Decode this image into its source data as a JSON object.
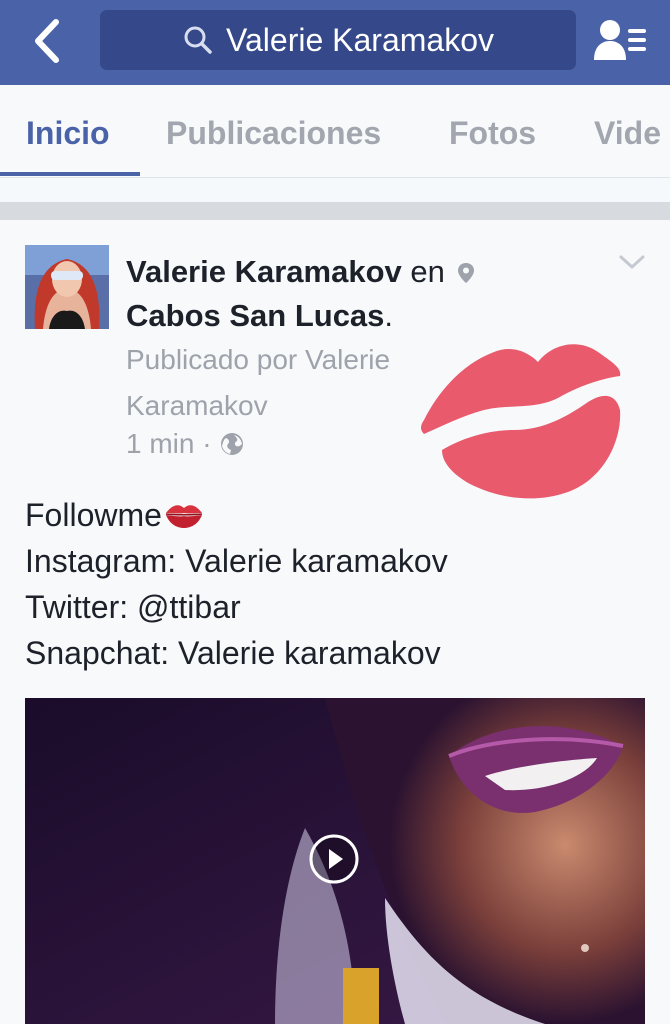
{
  "header": {
    "search_text": "Valerie Karamakov",
    "back_icon": "chevron-left-icon",
    "search_icon": "search-icon",
    "profile_icon": "friend-request-icon",
    "color": "#4a62a8"
  },
  "tabs": [
    {
      "label": "Inicio",
      "active": true
    },
    {
      "label": "Publicaciones",
      "active": false
    },
    {
      "label": "Fotos",
      "active": false
    },
    {
      "label": "Vide",
      "active": false
    }
  ],
  "post": {
    "author": "Valerie Karamakov",
    "connector": "en",
    "location": "Cabos San Lucas",
    "location_suffix": ".",
    "posted_by": "Publicado por Valerie Karamakov",
    "time": "1 min",
    "dot": "·",
    "privacy_icon": "globe-icon",
    "sticker": "kiss-lips-icon",
    "lines": [
      "Followme",
      "Instagram: Valerie karamakov",
      "Twitter: @ttibar",
      "Snapchat: Valerie karamakov"
    ],
    "first_line_emoji": "kiss-emoji",
    "video_icon": "play-icon"
  }
}
